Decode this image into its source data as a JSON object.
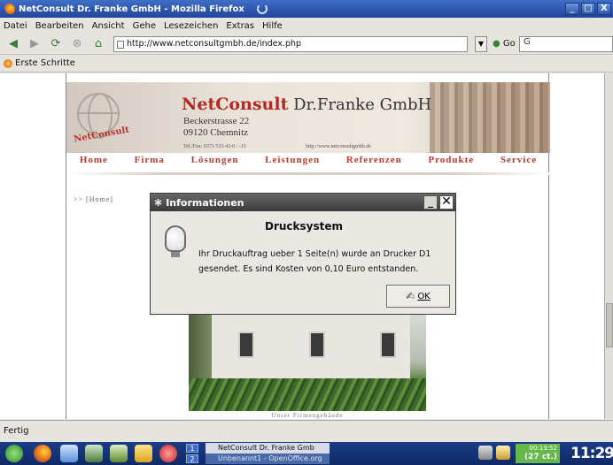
{
  "window": {
    "title": "NetConsult Dr. Franke GmbH - Mozilla Firefox",
    "min": "_",
    "max": "□",
    "close": "X"
  },
  "menu": [
    "Datei",
    "Bearbeiten",
    "Ansicht",
    "Gehe",
    "Lesezeichen",
    "Extras",
    "Hilfe"
  ],
  "nav": {
    "url": "http://www.netconsultgmbh.de/index.php",
    "go_label": "Go",
    "search_value": "G"
  },
  "bookmarks": {
    "item": "Erste Schritte"
  },
  "site": {
    "brand_name": "NetConsult",
    "brand_rest": "Dr.Franke GmbH",
    "logo_mini": "NetConsult",
    "street": "Beckerstrasse 22",
    "city": "09120 Chemnitz",
    "tel": "Tel./Fax: 0371/533 43-0 / -15",
    "web": "http://www.netconsultgmbh.de",
    "menu": [
      "Home",
      "Firma",
      "Lösungen",
      "Leistungen",
      "Referenzen",
      "Produkte",
      "Service"
    ],
    "breadcrumb": ">> [Home]",
    "caption": "Unser Firmengebäude"
  },
  "status": "Fertig",
  "dialog": {
    "title": "Informationen",
    "heading": "Drucksystem",
    "message": "Ihr Druckauftrag ueber 1 Seite(n) wurde an Drucker D1 gesendet. Es sind Kosten von 0,10 Euro entstanden.",
    "ok_label": "OK"
  },
  "taskbar": {
    "workspaces": [
      "1",
      "2"
    ],
    "tasks": [
      "NetConsult Dr. Franke Gmb",
      "Unbenannt1 - OpenOffice.org"
    ],
    "timer": "00:13:52",
    "cost": "(27 ct.)",
    "clock": "11:29"
  },
  "colors": {
    "accent": "#b22a22",
    "titlebar": "#21449a"
  }
}
